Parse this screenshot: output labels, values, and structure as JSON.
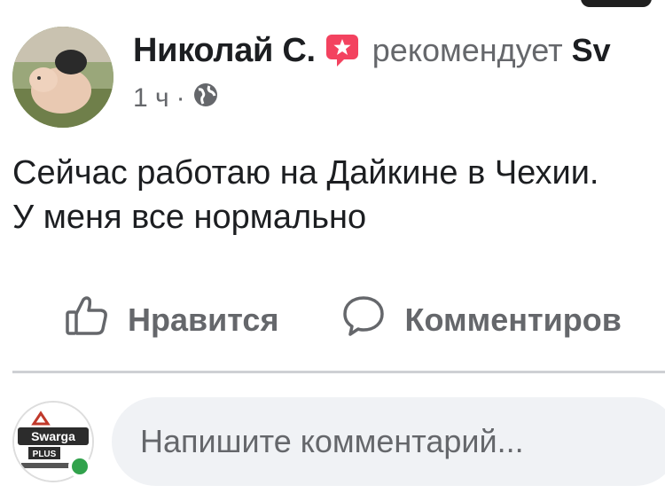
{
  "post": {
    "author": "Николай С.",
    "badge_icon": "recommend-star-icon",
    "badge_color": "#f3425f",
    "recommends_label": "рекомендует",
    "recommends_target": "Sv",
    "time": "1 ч",
    "separator": "·",
    "privacy_icon": "globe-icon",
    "text_line1": "Сейчас работаю на Дайкине в Чехии.",
    "text_line2": "У меня все нормально"
  },
  "actions": {
    "like_label": "Нравится",
    "like_icon": "thumbs-up-icon",
    "comment_label": "Комментиров",
    "comment_icon": "comment-bubble-icon"
  },
  "composer": {
    "placeholder": "Напишите комментарий...",
    "avatar_logo_text": "Swarga Plus",
    "online_color": "#31a24c"
  }
}
